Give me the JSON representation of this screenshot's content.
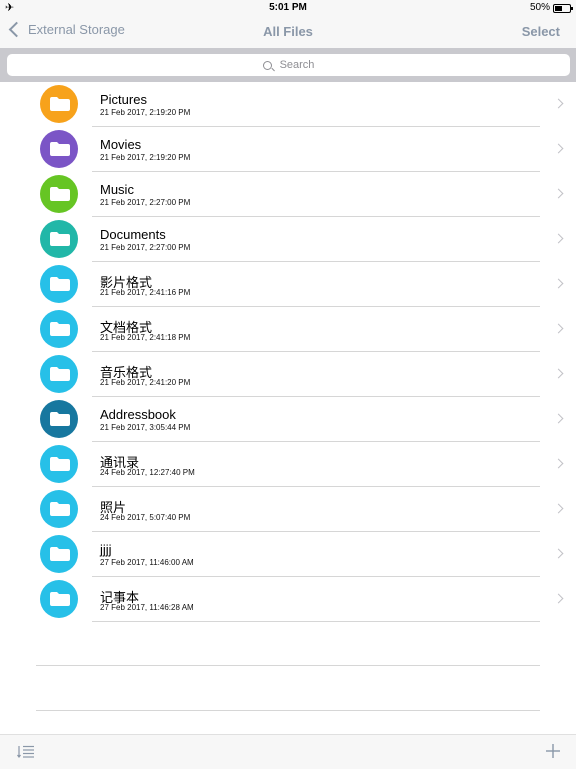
{
  "status_bar": {
    "airplane_icon": "airplane-icon",
    "time": "5:01 PM",
    "battery": "50%"
  },
  "nav": {
    "back_label": "External Storage",
    "title": "All Files",
    "select_label": "Select"
  },
  "search": {
    "placeholder": "Search"
  },
  "files": [
    {
      "name": "Pictures",
      "date": "21 Feb 2017, 2:19:20 PM",
      "color": "#f7a21b",
      "icon": "pictures-folder-icon"
    },
    {
      "name": "Movies",
      "date": "21 Feb 2017, 2:19:20 PM",
      "color": "#7b55c6",
      "icon": "movies-folder-icon"
    },
    {
      "name": "Music",
      "date": "21 Feb 2017, 2:27:00 PM",
      "color": "#66c524",
      "icon": "music-folder-icon"
    },
    {
      "name": "Documents",
      "date": "21 Feb 2017, 2:27:00 PM",
      "color": "#21b7a8",
      "icon": "documents-folder-icon"
    },
    {
      "name": "影片格式",
      "date": "21 Feb 2017, 2:41:16 PM",
      "color": "#27c0e8",
      "icon": "folder-icon"
    },
    {
      "name": "文档格式",
      "date": "21 Feb 2017, 2:41:18 PM",
      "color": "#27c0e8",
      "icon": "folder-icon"
    },
    {
      "name": "音乐格式",
      "date": "21 Feb 2017, 2:41:20 PM",
      "color": "#27c0e8",
      "icon": "folder-icon"
    },
    {
      "name": "Addressbook",
      "date": "21 Feb 2017, 3:05:44 PM",
      "color": "#17779f",
      "icon": "addressbook-folder-icon"
    },
    {
      "name": "通讯录",
      "date": "24 Feb 2017, 12:27:40 PM",
      "color": "#27c0e8",
      "icon": "folder-icon"
    },
    {
      "name": "照片",
      "date": "24 Feb 2017, 5:07:40 PM",
      "color": "#27c0e8",
      "icon": "folder-icon"
    },
    {
      "name": "jjjj",
      "date": "27 Feb 2017, 11:46:00 AM",
      "color": "#27c0e8",
      "icon": "folder-icon"
    },
    {
      "name": "记事本",
      "date": "27 Feb 2017, 11:46:28 AM",
      "color": "#27c0e8",
      "icon": "folder-icon"
    }
  ],
  "toolbar": {
    "sort_icon": "sort-list-icon",
    "add_icon": "plus-icon"
  }
}
